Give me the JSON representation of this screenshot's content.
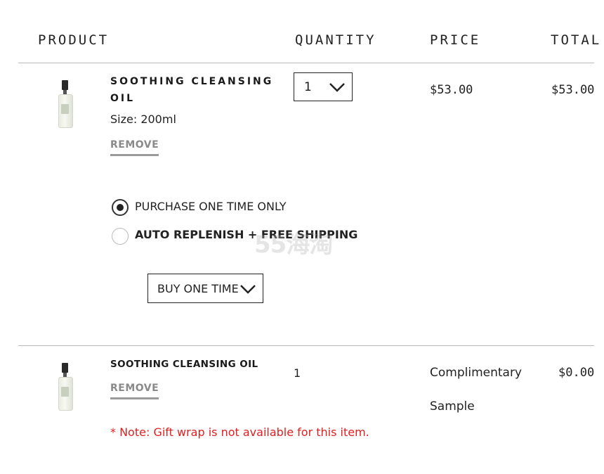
{
  "table_headers": {
    "product": "PRODUCT",
    "quantity": "QUANTITY",
    "price": "PRICE",
    "total": "TOTAL"
  },
  "items": [
    {
      "name_line1": "SOOTHING CLEANSING",
      "name_line2": "OIL",
      "size_label": "Size: 200ml",
      "remove_label": "REMOVE",
      "quantity": "1",
      "price": "$53.00",
      "total": "$53.00",
      "purchase_options": [
        {
          "label": "PURCHASE ONE TIME ONLY",
          "selected": true
        },
        {
          "label": "AUTO REPLENISH + FREE SHIPPING",
          "selected": false
        }
      ],
      "frequency_value": "BUY ONE TIME"
    },
    {
      "name": "SOOTHING CLEANSING OIL",
      "remove_label": "REMOVE",
      "quantity": "1",
      "price_line1": "Complimentary",
      "price_line2": "Sample",
      "total": "$0.00",
      "note": "* Note: Gift wrap is not available for this item."
    }
  ],
  "watermark": "55海淘",
  "icons": {
    "dropdown": "chevron-down-icon",
    "product_image": "bottle-icon"
  },
  "colors": {
    "accent_red": "#e02020",
    "remove_gray": "#8a8a8a",
    "rule": "#b8b8b8"
  }
}
